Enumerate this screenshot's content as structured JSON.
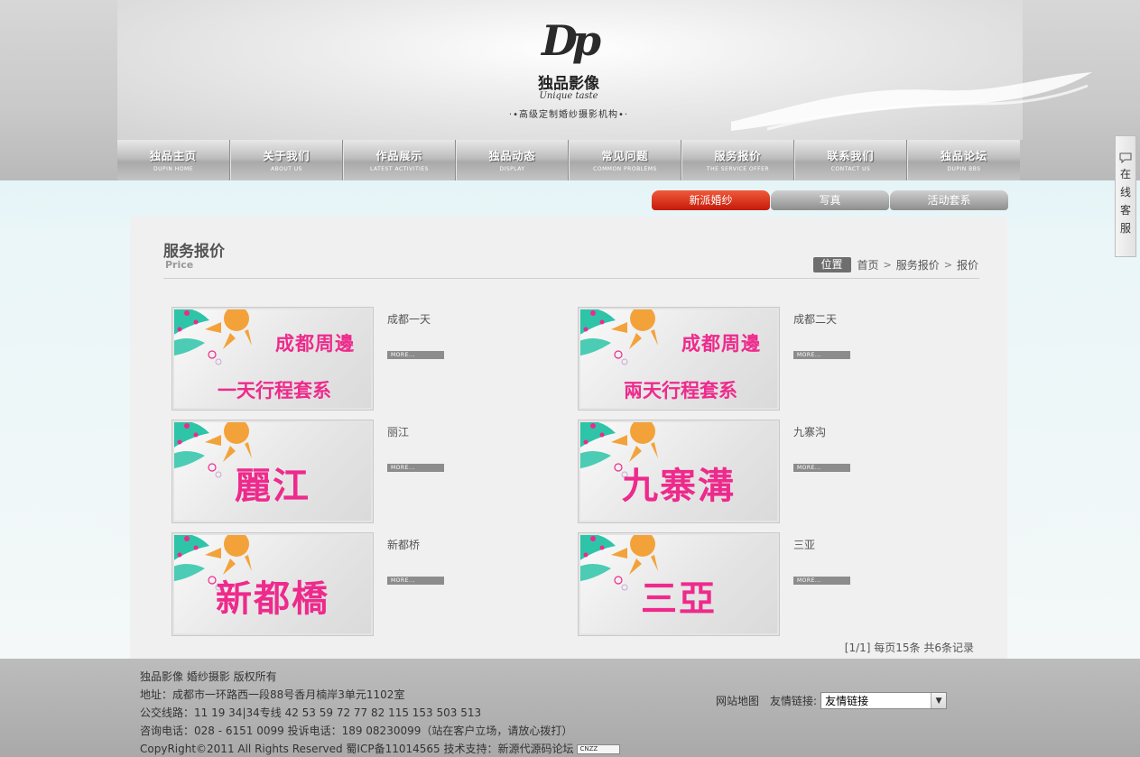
{
  "brand": {
    "logo_mark": "Dp",
    "name": "独品影像",
    "name_en": "Unique taste",
    "slogan": "·•高级定制婚纱摄影机构•·"
  },
  "nav": [
    {
      "cn": "独品主页",
      "en": "DUPIN HOME"
    },
    {
      "cn": "关于我们",
      "en": "ABOUT US"
    },
    {
      "cn": "作品展示",
      "en": "LATEST ACTIVITIES"
    },
    {
      "cn": "独品动态",
      "en": "DISPLAY"
    },
    {
      "cn": "常见问题",
      "en": "COMMON PROBLEMS"
    },
    {
      "cn": "服务报价",
      "en": "THE SERVICE OFFER"
    },
    {
      "cn": "联系我们",
      "en": "CONTACT US"
    },
    {
      "cn": "独品论坛",
      "en": "DUPIN BBS"
    }
  ],
  "subtabs": [
    "新派婚纱",
    "写真",
    "活动套系"
  ],
  "page": {
    "title": "服务报价",
    "subtitle": "Price"
  },
  "breadcrumb": {
    "tag": "位置",
    "items": [
      "首页",
      "服务报价",
      "报价"
    ],
    "sep": ">"
  },
  "items": [
    {
      "title": "成都一天",
      "line1": "成都周邊",
      "line2": "一天行程套系",
      "big": ""
    },
    {
      "title": "成都二天",
      "line1": "成都周邊",
      "line2": "兩天行程套系",
      "big": ""
    },
    {
      "title": "丽江",
      "line1": "",
      "line2": "",
      "big": "麗江"
    },
    {
      "title": "九寨沟",
      "line1": "",
      "line2": "",
      "big": "九寨溝"
    },
    {
      "title": "新都桥",
      "line1": "",
      "line2": "",
      "big": "新都橋"
    },
    {
      "title": "三亚",
      "line1": "",
      "line2": "",
      "big": "三亞"
    }
  ],
  "more_label": "MORE...",
  "pager": "[1/1] 每页15条 共6条记录",
  "footer": {
    "lines": [
      "独品影像 婚纱摄影 版权所有",
      "地址：成都市一环路西一段88号香月楠岸3单元1102室",
      "公交线路：11 19 34|34专线 42 53 59 72 77 82 115 153 503 513",
      "咨询电话：028 - 6151 0099 投诉电话：189 08230099（站在客户立场，请放心拨打）",
      "CopyRight©2011 All Rights Reserved 蜀ICP备11014565 技术支持：新源代源码论坛"
    ],
    "cnzz": "CNZZ",
    "sitemap": "网站地图",
    "friend_label": "友情链接:",
    "friend_selected": "友情链接"
  },
  "side_service": {
    "text": "在线客服"
  },
  "colors": {
    "accent": "#ee2a8c",
    "active_tab": "#d8260f"
  }
}
